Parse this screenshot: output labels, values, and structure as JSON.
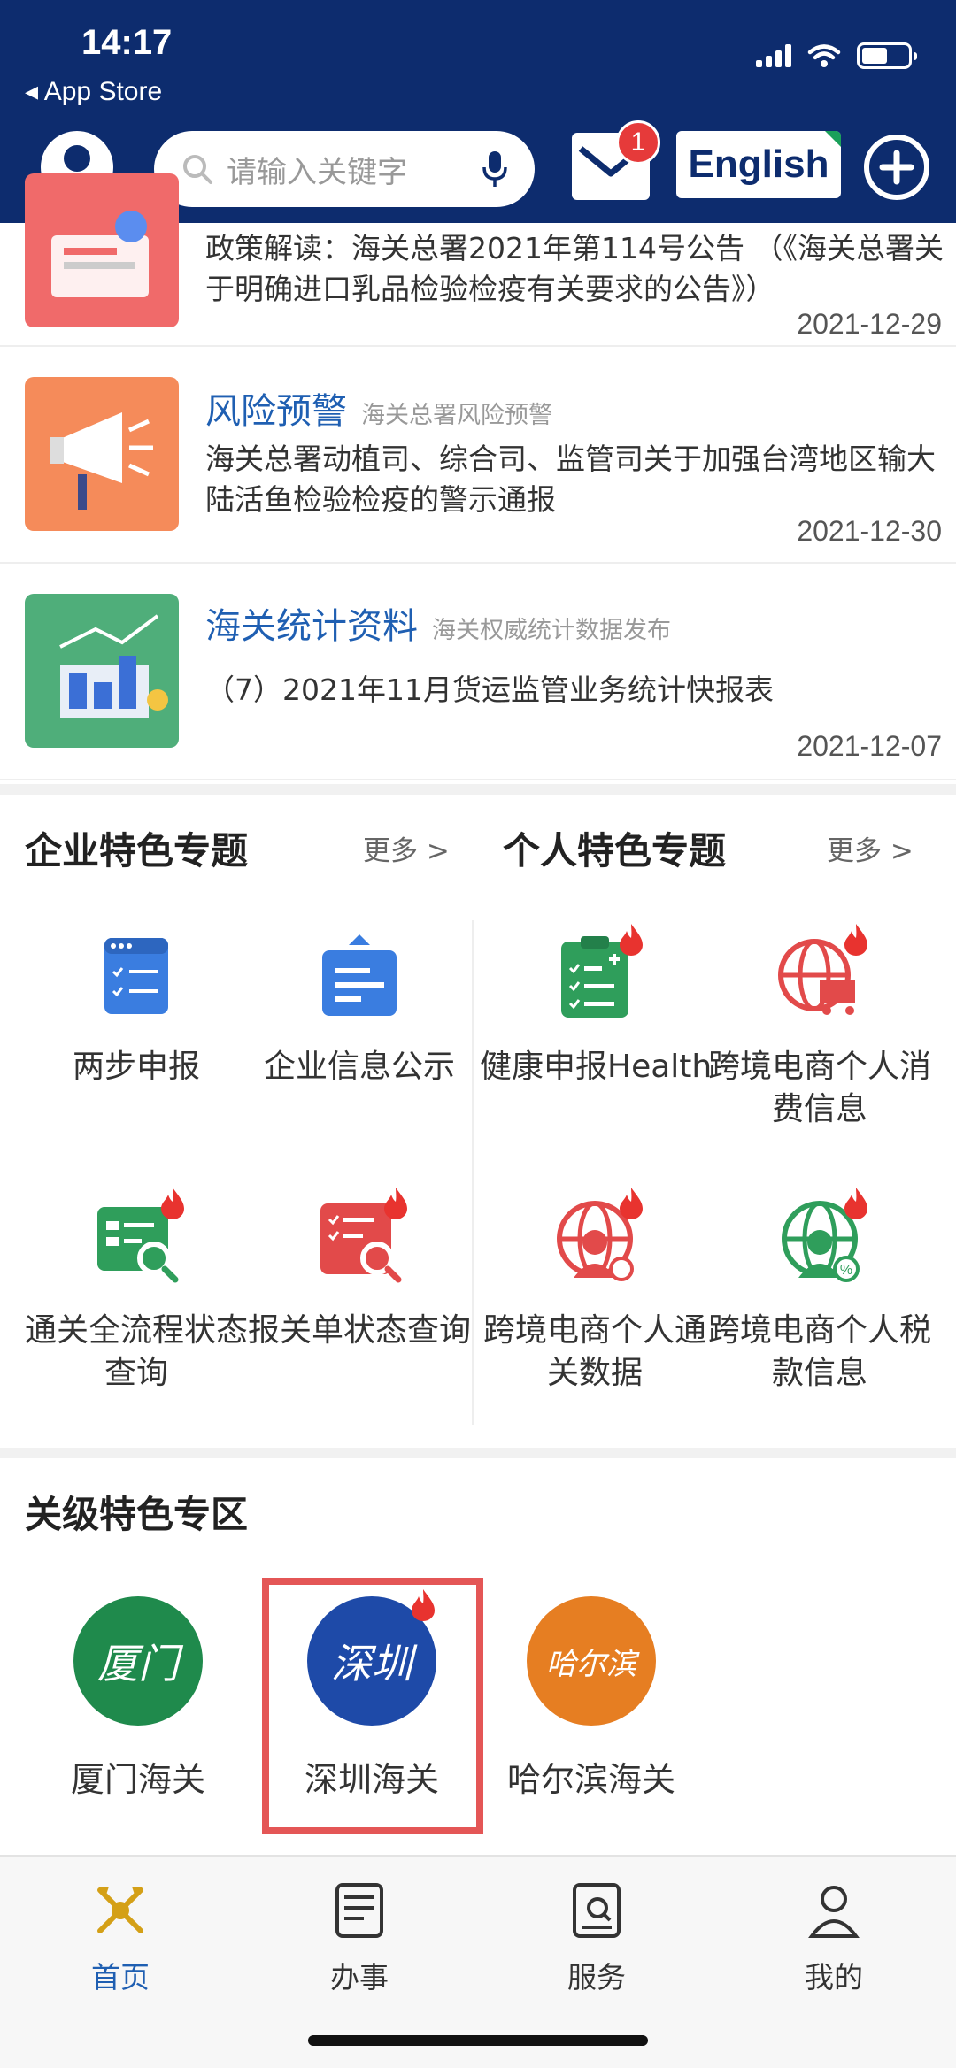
{
  "status_bar": {
    "time": "14:17",
    "back_label": "◂ App Store"
  },
  "header": {
    "search_placeholder": "请输入关键字",
    "mail_badge": "1",
    "english_label": "English"
  },
  "news": [
    {
      "category": "",
      "subtitle": "",
      "text": "政策解读：海关总署2021年第114号公告 （《海关总署关于明确进口乳品检验检疫有关要求的公告》）",
      "date": "2021-12-29"
    },
    {
      "category": "风险预警",
      "subtitle": "海关总署风险预警",
      "text": "海关总署动植司、综合司、监管司关于加强台湾地区输大陆活鱼检验检疫的警示通报",
      "date": "2021-12-30"
    },
    {
      "category": "海关统计资料",
      "subtitle": "海关权威统计数据发布",
      "text": "（7）2021年11月货运监管业务统计快报表",
      "date": "2021-12-07"
    }
  ],
  "enterprise_topics": {
    "title": "企业特色专题",
    "more": "更多 >",
    "items": [
      {
        "label": "两步申报",
        "icon": "list-doc-icon"
      },
      {
        "label": "企业信息公示",
        "icon": "id-card-icon"
      },
      {
        "label": "通关全流程状态查询",
        "icon": "search-doc-icon"
      },
      {
        "label": "报关单状态查询",
        "icon": "search-doc-icon"
      }
    ]
  },
  "personal_topics": {
    "title": "个人特色专题",
    "more": "更多 >",
    "items": [
      {
        "label": "健康申报HealthDec…",
        "icon": "clipboard-icon"
      },
      {
        "label": "跨境电商个人消费信息",
        "icon": "globe-cart-icon"
      },
      {
        "label": "跨境电商个人通关数据",
        "icon": "globe-person-icon"
      },
      {
        "label": "跨境电商个人税款信息",
        "icon": "globe-tax-icon"
      }
    ]
  },
  "customs_zone": {
    "title": "关级特色专区",
    "items": [
      {
        "label": "厦门海关",
        "logo_text": "厦门",
        "color": "#1f8a4c"
      },
      {
        "label": "深圳海关",
        "logo_text": "深圳",
        "color": "#1e4aa8"
      },
      {
        "label": "哈尔滨海关",
        "logo_text": "哈尔滨",
        "color": "#e67e22"
      }
    ]
  },
  "bottom_nav": [
    {
      "label": "首页",
      "active": true
    },
    {
      "label": "办事",
      "active": false
    },
    {
      "label": "服务",
      "active": false
    },
    {
      "label": "我的",
      "active": false
    }
  ],
  "colors": {
    "header": "#0d2c6e",
    "accent": "#1f5fb2",
    "blue_icon": "#3a7de0",
    "green_icon": "#2f9e5b",
    "red_icon": "#e24a4a",
    "highlight": "#e45656"
  }
}
